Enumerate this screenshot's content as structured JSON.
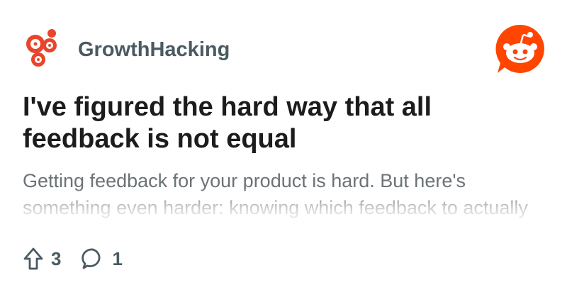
{
  "community": {
    "name": "GrowthHacking",
    "icon": "gears-icon"
  },
  "brand": {
    "icon": "reddit-snoo-icon",
    "color": "#ff4500"
  },
  "post": {
    "title": "I've figured the hard way that all feedback is not equal",
    "body": "Getting feedback for your product is hard. But here's something even harder: knowing which feedback to actually act on."
  },
  "actions": {
    "upvotes": "3",
    "comments": "1",
    "upvote_icon": "upvote-arrow-icon",
    "comment_icon": "comment-bubble-icon"
  }
}
